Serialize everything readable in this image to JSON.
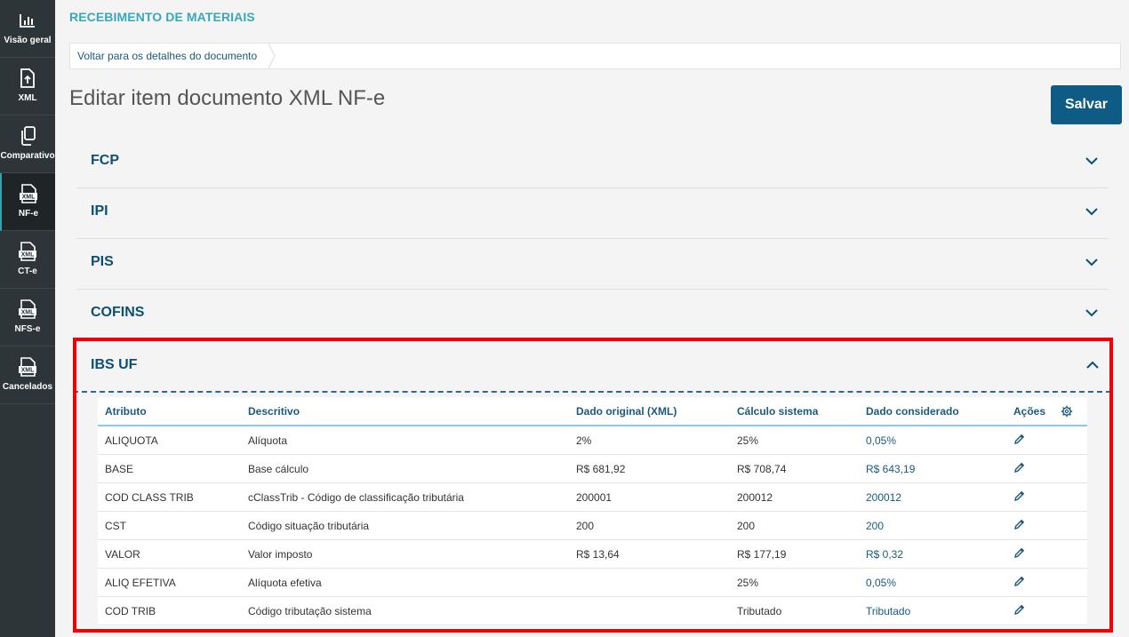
{
  "sidebar": {
    "items": [
      {
        "label": "Visão geral",
        "icon": "bar-chart-icon"
      },
      {
        "label": "XML",
        "icon": "file-upload-icon"
      },
      {
        "label": "Comparativo",
        "icon": "copy-icon"
      },
      {
        "label": "NF-e",
        "icon": "xml-file-icon",
        "active": true
      },
      {
        "label": "CT-e",
        "icon": "xml-file-icon"
      },
      {
        "label": "NFS-e",
        "icon": "xml-file-icon"
      },
      {
        "label": "Cancelados",
        "icon": "xml-file-icon"
      }
    ]
  },
  "header": {
    "module_title": "RECEBIMENTO DE MATERIAIS",
    "breadcrumb": "Voltar para os detalhes do documento",
    "page_title": "Editar item documento XML NF-e",
    "save_label": "Salvar"
  },
  "sections": [
    {
      "label": "FCP",
      "expanded": false
    },
    {
      "label": "IPI",
      "expanded": false
    },
    {
      "label": "PIS",
      "expanded": false
    },
    {
      "label": "COFINS",
      "expanded": false
    },
    {
      "label": "IBS UF",
      "expanded": true
    }
  ],
  "table": {
    "headers": {
      "atributo": "Atributo",
      "descritivo": "Descritivo",
      "original": "Dado original (XML)",
      "calculo": "Cálculo sistema",
      "considerado": "Dado considerado",
      "acoes": "Ações"
    },
    "rows": [
      {
        "atributo": "ALIQUOTA",
        "descritivo": "Alíquota",
        "original": "2%",
        "calculo": "25%",
        "considerado": "0,05%"
      },
      {
        "atributo": "BASE",
        "descritivo": "Base cálculo",
        "original": "R$ 681,92",
        "calculo": "R$ 708,74",
        "considerado": "R$ 643,19"
      },
      {
        "atributo": "COD CLASS TRIB",
        "descritivo": "cClassTrib - Código de classificação tributária",
        "original": "200001",
        "calculo": "200012",
        "considerado": "200012"
      },
      {
        "atributo": "CST",
        "descritivo": "Código situação tributária",
        "original": "200",
        "calculo": "200",
        "considerado": "200"
      },
      {
        "atributo": "VALOR",
        "descritivo": "Valor imposto",
        "original": "R$ 13,64",
        "calculo": "R$ 177,19",
        "considerado": "R$ 0,32"
      },
      {
        "atributo": "ALIQ EFETIVA",
        "descritivo": "Alíquota efetiva",
        "original": "",
        "calculo": "25%",
        "considerado": "0,05%"
      },
      {
        "atributo": "COD TRIB",
        "descritivo": "Código tributação sistema",
        "original": "",
        "calculo": "Tributado",
        "considerado": "Tributado"
      }
    ]
  },
  "colors": {
    "sidebar_bg": "#2d3538",
    "accent": "#3aa7b9",
    "primary": "#0e5b85",
    "highlight_border": "#ee0000"
  }
}
